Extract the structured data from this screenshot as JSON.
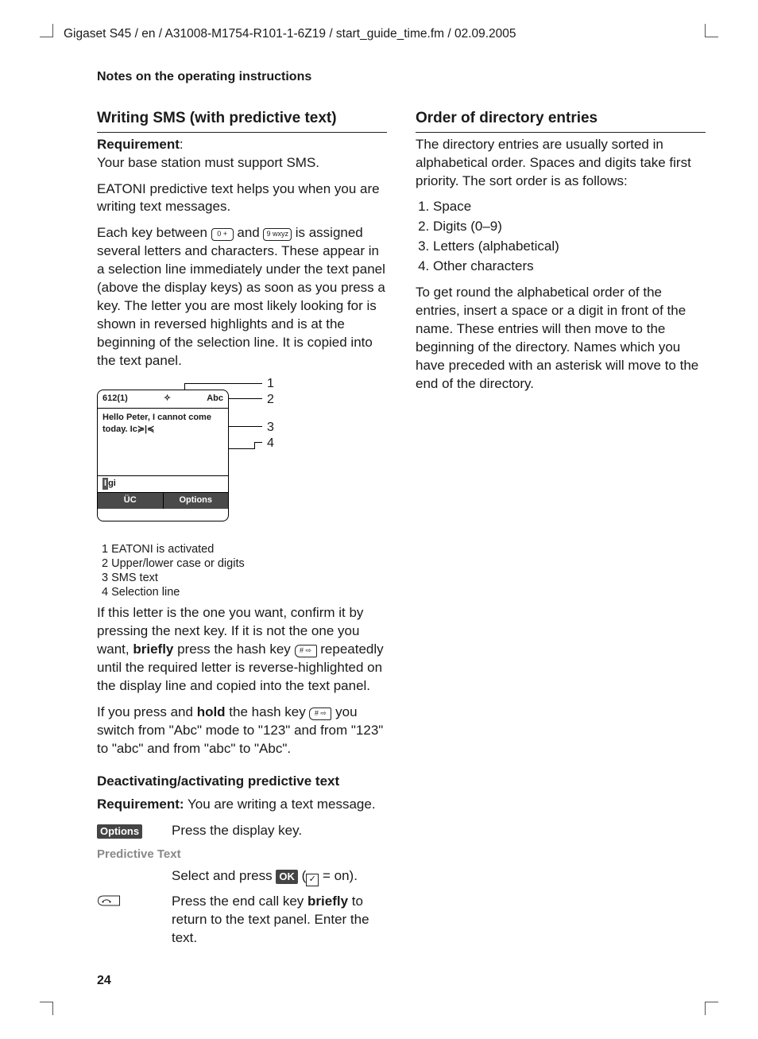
{
  "header": "Gigaset S45 / en / A31008-M1754-R101-1-6Z19 / start_guide_time.fm / 02.09.2005",
  "section_title": "Notes on the operating instructions",
  "page_number": "24",
  "left": {
    "heading": "Writing SMS (with predictive text)",
    "req_label": "Requirement",
    "req_colon": ":",
    "req_text": "Your base station must support SMS.",
    "p1": "EATONI predictive text helps you when you are writing text messages.",
    "p2a": "Each key between ",
    "key0": "0 +",
    "p2b": " and ",
    "key9": "9 wxyz",
    "p2c": " is assigned several letters and characters. These appear in a selection line immediately under the text panel (above the display keys) as soon as you press a key. The letter you are most likely looking for is shown in reversed highlights and is at the beginning of the selection line. It is copied into the text panel.",
    "display": {
      "count": "612(1)",
      "eatoni_icon": "✧",
      "abc": "Abc",
      "line1": "Hello Peter, I cannot come",
      "line2a": "today. Ic",
      "cursor_marks": "≽|≼",
      "sel_hl": "I",
      "sel_rest": "gi",
      "sk_left": "ÜC",
      "sk_right": "Options"
    },
    "callouts": {
      "n1": "1",
      "n2": "2",
      "n3": "3",
      "n4": "4"
    },
    "legend": {
      "l1": "1 EATONI is activated",
      "l2": "2 Upper/lower case or digits",
      "l3": "3 SMS text",
      "l4": "4 Selection line"
    },
    "p3a": "If this letter is the one you want, confirm it by pressing the next key. If it is not the one you want, ",
    "p3_bold": "briefly",
    "p3b": " press the hash key ",
    "hash_key": "# ⇨",
    "p3c": " repeatedly until the required letter is reverse-highlighted on the display line and copied into the text panel.",
    "p4a": "If you press and ",
    "p4_bold": "hold",
    "p4b": " the hash key ",
    "p4c": " you switch from \"Abc\" mode to \"123\" and from \"123\" to \"abc\" and from \"abc\" to \"Abc\".",
    "sub_heading": "Deactivating/activating predictive text",
    "req2_label": "Requirement:",
    "req2_text": " You are writing a text message.",
    "step1_key": "Options",
    "step1_text": "Press the display key.",
    "menu_item": "Predictive Text",
    "step2a": "Select and press ",
    "ok_key": "OK",
    "step2b": " (",
    "check": "✓",
    "step2c": " = on).",
    "step3a": "Press the end call key ",
    "step3_bold": "briefly",
    "step3b": " to return to the text panel. Enter the text."
  },
  "right": {
    "heading": "Order of directory entries",
    "p1": "The directory entries are usually sorted in alphabetical order. Spaces and digits take first priority. The sort order is as follows:",
    "list": {
      "i1": "Space",
      "i2": "Digits (0–9)",
      "i3": "Letters (alphabetical)",
      "i4": "Other characters"
    },
    "p2": "To get round the alphabetical order of the entries, insert a space or a digit in front of the name. These entries will then move to the beginning of the directory. Names which you have preceded with an asterisk will move to the end of the directory."
  }
}
